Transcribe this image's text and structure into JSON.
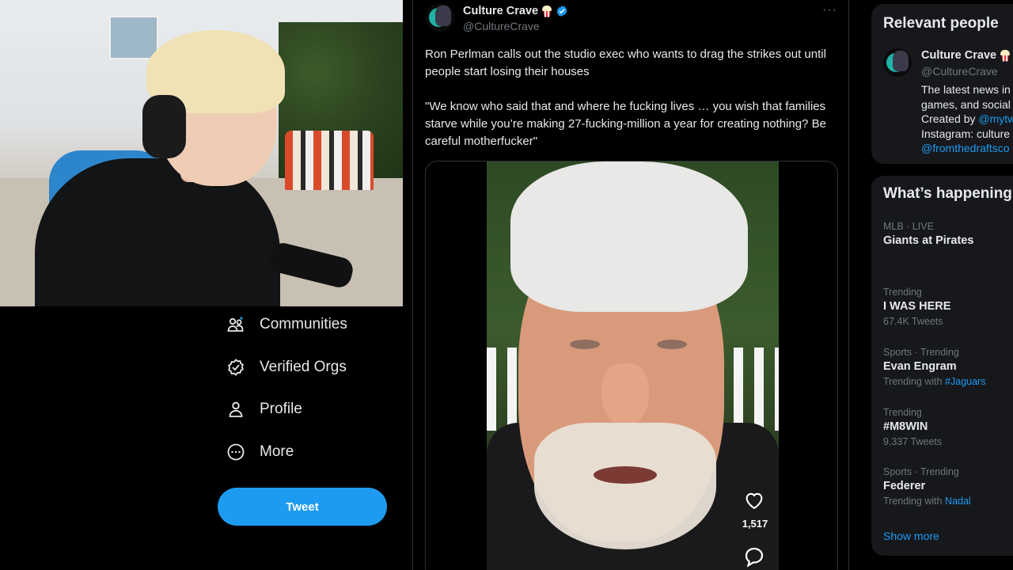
{
  "nav": {
    "items": [
      {
        "label": "Communities",
        "icon": "communities-icon"
      },
      {
        "label": "Verified Orgs",
        "icon": "verified-orgs-icon"
      },
      {
        "label": "Profile",
        "icon": "profile-icon"
      },
      {
        "label": "More",
        "icon": "more-circle-icon"
      }
    ],
    "tweet_button": "Tweet"
  },
  "tweet": {
    "display_name": "Culture Crave",
    "handle": "@CultureCrave",
    "more": "···",
    "text_line1": "Ron Perlman calls out the studio exec who wants to drag the strikes out until people start losing their houses",
    "text_line2": "\"We know who said that and where he fucking lives … you wish that families starve while you’re making 27-fucking-million a year for creating nothing? Be careful motherfucker\"",
    "like_count": "1,517"
  },
  "relevant_people": {
    "title": "Relevant people",
    "person": {
      "name": "Culture Crave",
      "handle": "@CultureCrave",
      "bio_line1": "The latest news in",
      "bio_line2": "games, and social",
      "bio_line3_prefix": "Created by ",
      "bio_line3_link": "@mytw",
      "bio_line4": "Instagram: culture",
      "bio_line5_link": "@fromthedraftsco"
    }
  },
  "whats_happening": {
    "title": "What’s happening",
    "trends": [
      {
        "meta": "MLB · LIVE",
        "topic": "Giants at Pirates",
        "sub": "",
        "sub_link": ""
      },
      {
        "meta": "Trending",
        "topic": "I WAS HERE",
        "sub": "67.4K Tweets",
        "sub_link": ""
      },
      {
        "meta": "Sports · Trending",
        "topic": "Evan Engram",
        "sub": "Trending with ",
        "sub_link": "#Jaguars"
      },
      {
        "meta": "Trending",
        "topic": "#M8WIN",
        "sub": "9,337 Tweets",
        "sub_link": ""
      },
      {
        "meta": "Sports · Trending",
        "topic": "Federer",
        "sub": "Trending with ",
        "sub_link": "Nadal"
      }
    ],
    "show_more": "Show more"
  },
  "colors": {
    "accent": "#1d9bf0",
    "background": "#000000",
    "card": "#16181c",
    "muted": "#71767b"
  }
}
